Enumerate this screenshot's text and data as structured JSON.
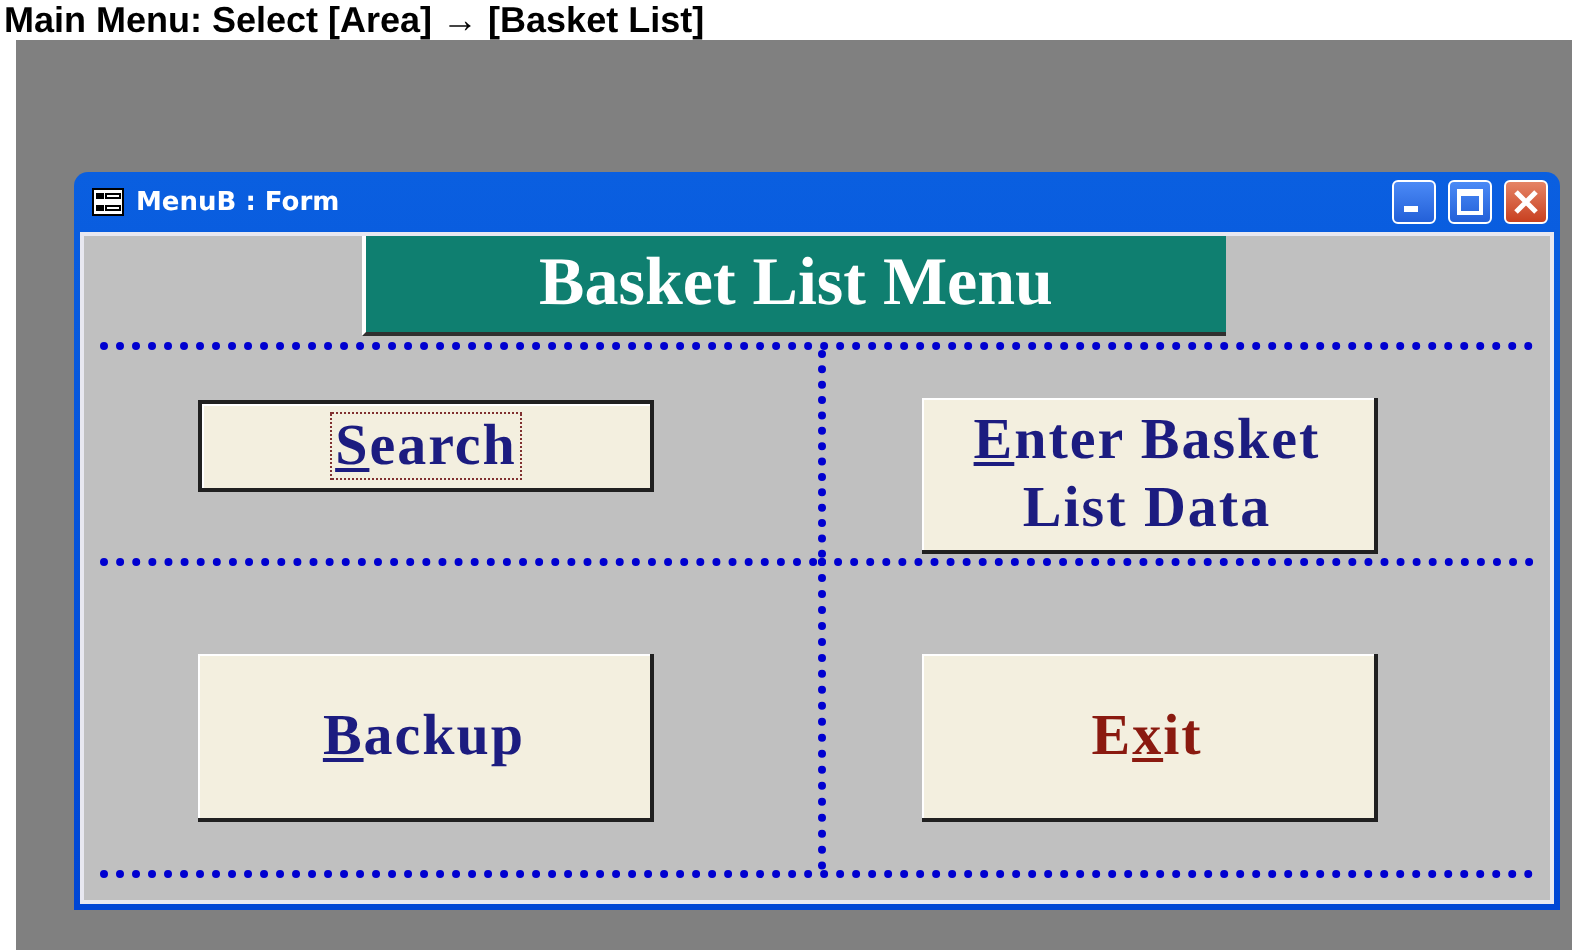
{
  "page_heading": "Main Menu: Select [Area] → [Basket List]",
  "window": {
    "title": "MenuB : Form"
  },
  "banner": "Basket List Menu",
  "buttons": [
    {
      "accel": "S",
      "after": "earch",
      "color": "#1c1c80",
      "focused": true
    },
    {
      "accel": "E",
      "after": "nter Basket List Data",
      "color": "#1c1c80",
      "focused": false
    },
    {
      "accel": "B",
      "after": "ackup",
      "color": "#1c1c80",
      "focused": false
    },
    {
      "before": "E",
      "accel": "x",
      "after": "it",
      "color": "#8a1a10",
      "focused": false
    }
  ]
}
